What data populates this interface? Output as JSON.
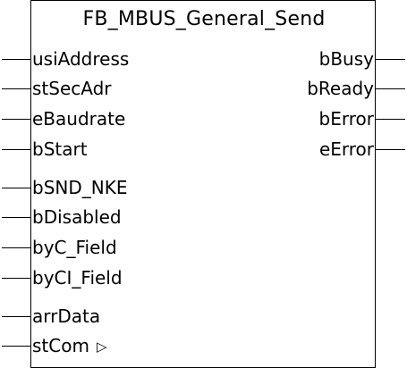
{
  "block": {
    "title": "FB_MBUS_General_Send",
    "inputs": [
      {
        "name": "usiAddress"
      },
      {
        "name": "stSecAdr"
      },
      {
        "name": "eBaudrate"
      },
      {
        "name": "bStart"
      },
      {
        "name": "bSND_NKE"
      },
      {
        "name": "bDisabled"
      },
      {
        "name": "byC_Field"
      },
      {
        "name": "byCI_Field"
      },
      {
        "name": "arrData"
      },
      {
        "name": "stCom",
        "marker": "▷"
      }
    ],
    "outputs": [
      {
        "name": "bBusy"
      },
      {
        "name": "bReady"
      },
      {
        "name": "bError"
      },
      {
        "name": "eError"
      }
    ]
  }
}
